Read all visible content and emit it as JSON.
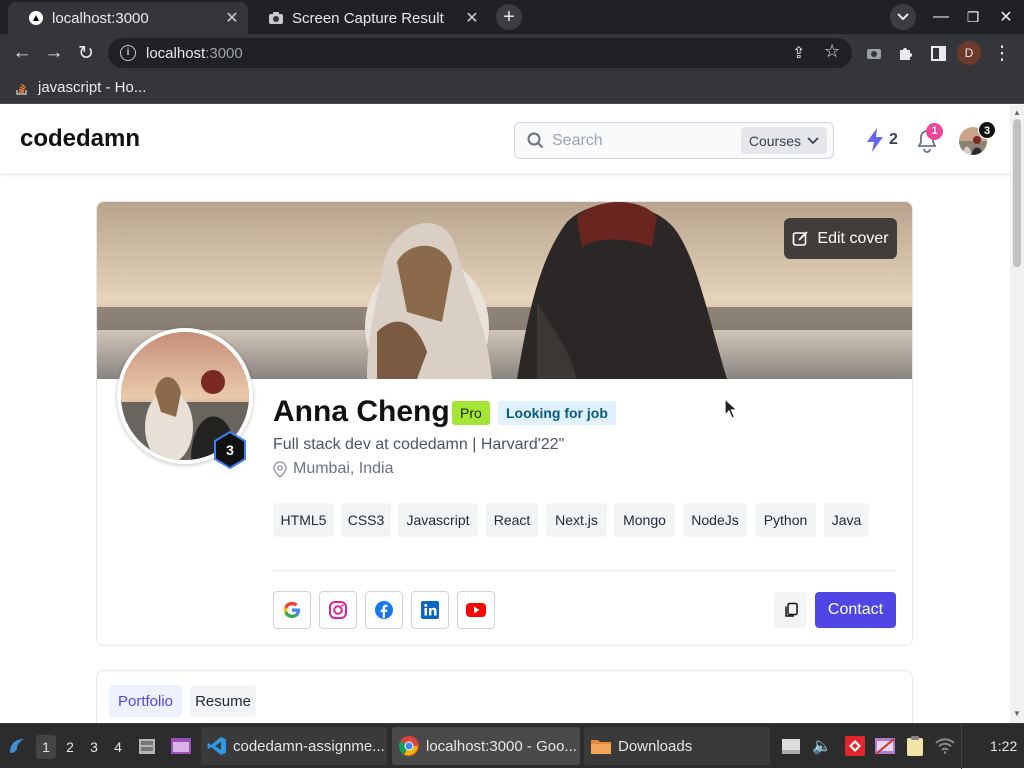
{
  "browser": {
    "tabs": [
      {
        "title": "localhost:3000",
        "active": true
      },
      {
        "title": "Screen Capture Result",
        "active": false
      }
    ],
    "url_host": "localhost",
    "url_port": ":3000",
    "profile_initial": "D",
    "bookmark": "javascript - Ho..."
  },
  "site": {
    "logo": "codedamn",
    "search_placeholder": "Search",
    "search_scope": "Courses",
    "streak_count": "2",
    "notification_count": "1",
    "avatar_level": "3"
  },
  "profile": {
    "edit_cover_label": "Edit cover",
    "name": "Anna Cheng",
    "pro_badge": "Pro",
    "job_badge": "Looking for job",
    "bio": "Full stack dev at codedamn | Harvard'22\"",
    "location": "Mumbai, India",
    "level": "3",
    "skills": [
      "HTML5",
      "CSS3",
      "Javascript",
      "React",
      "Next.js",
      "Mongo",
      "NodeJs",
      "Python",
      "Java"
    ],
    "socials": [
      "google-icon",
      "instagram-icon",
      "facebook-icon",
      "linkedin-icon",
      "youtube-icon"
    ],
    "contact_label": "Contact"
  },
  "page_tabs": [
    {
      "label": "Portfolio",
      "active": true
    },
    {
      "label": "Resume",
      "active": false
    }
  ],
  "taskbar": {
    "workspaces": [
      "1",
      "2",
      "3",
      "4"
    ],
    "tasks": [
      {
        "label": "codedamn-assignme...",
        "icon": "vscode-icon"
      },
      {
        "label": "localhost:3000 - Goo...",
        "icon": "chrome-icon"
      },
      {
        "label": "Downloads",
        "icon": "folder-icon"
      }
    ],
    "clock": "1:22"
  },
  "colors": {
    "accent": "#4f46e5",
    "pro_bg": "#a3e635",
    "job_bg": "#e0f2fe",
    "job_fg": "#075985",
    "bolt": "#6366f1",
    "notif": "#ec4899"
  }
}
